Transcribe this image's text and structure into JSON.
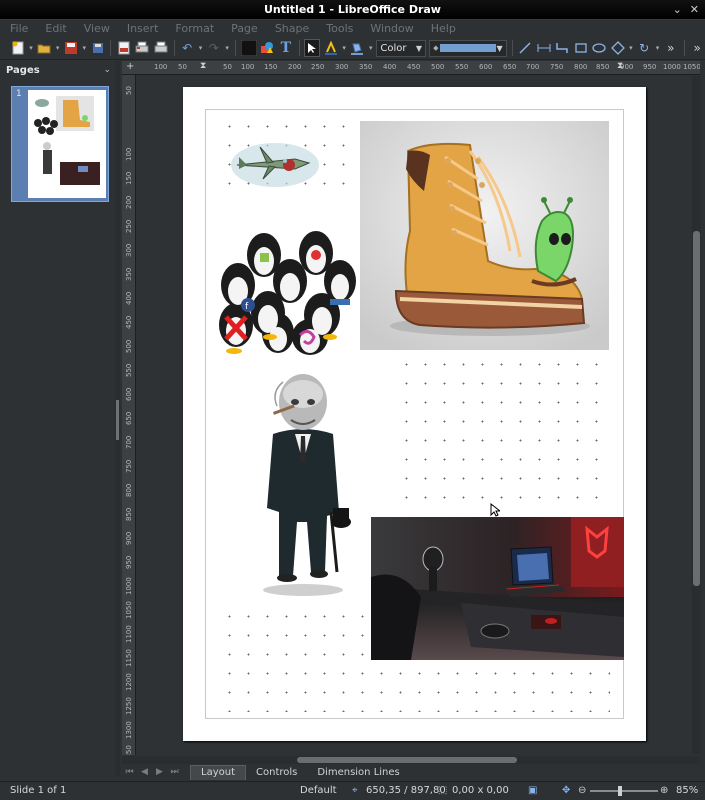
{
  "window": {
    "title": "Untitled 1 - LibreOffice Draw",
    "controls": [
      "⌄",
      "✕"
    ]
  },
  "menu": [
    "File",
    "Edit",
    "View",
    "Insert",
    "Format",
    "Page",
    "Shape",
    "Tools",
    "Window",
    "Help"
  ],
  "toolbar": {
    "color_mode": "Color",
    "overflow": "»",
    "icons": [
      "new-icon",
      "open-icon",
      "save-icon",
      "export-icon",
      "export-pdf-icon",
      "print-icon",
      "undo-icon",
      "redo-icon",
      "grid-icon",
      "image-icon",
      "fontwork-icon",
      "select-icon",
      "line-color-icon",
      "area-fill-icon",
      "line-icon",
      "dimension-icon",
      "connector-icon",
      "rectangle-icon",
      "ellipse-icon",
      "diamond-icon",
      "rotate-icon"
    ]
  },
  "sidebar": {
    "title": "Pages",
    "page_number": "1"
  },
  "rulers": {
    "horizontal": [
      "100",
      "50",
      "50",
      "100",
      "150",
      "200",
      "250",
      "300",
      "350",
      "400",
      "450",
      "500",
      "550",
      "600",
      "650",
      "700",
      "750",
      "800",
      "850",
      "900",
      "950",
      "1000",
      "1050",
      "1100"
    ],
    "vertical": [
      "50",
      "100",
      "150",
      "200",
      "250",
      "300",
      "350",
      "400",
      "450",
      "500",
      "550",
      "600",
      "650",
      "700",
      "750",
      "800",
      "850",
      "900",
      "950",
      "1000",
      "1050",
      "1100",
      "1150",
      "1200",
      "1250",
      "1300",
      "1350",
      "1400",
      "1450"
    ]
  },
  "canvas": {
    "images": [
      "plane-clipart",
      "penguins-clipart",
      "boot-clipart",
      "man-clipart",
      "gaming-desk-photo"
    ]
  },
  "tabs": [
    "Layout",
    "Controls",
    "Dimension Lines"
  ],
  "status": {
    "slide": "Slide 1 of 1",
    "style": "Default",
    "position": "650,35 / 897,80",
    "size": "0,00 x 0,00",
    "zoom": "85%"
  }
}
